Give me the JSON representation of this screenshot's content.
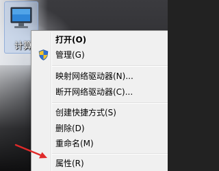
{
  "desktop": {
    "icon_label": "计算"
  },
  "menu": {
    "items": [
      {
        "label": "打开(O)"
      },
      {
        "label": "管理(G)"
      },
      {
        "label": "映射网络驱动器(N)..."
      },
      {
        "label": "断开网络驱动器(C)..."
      },
      {
        "label": "创建快捷方式(S)"
      },
      {
        "label": "删除(D)"
      },
      {
        "label": "重命名(M)"
      },
      {
        "label": "属性(R)"
      }
    ]
  },
  "colors": {
    "menu_bg": "#f0f0f0",
    "arrow": "#e02a2a"
  }
}
